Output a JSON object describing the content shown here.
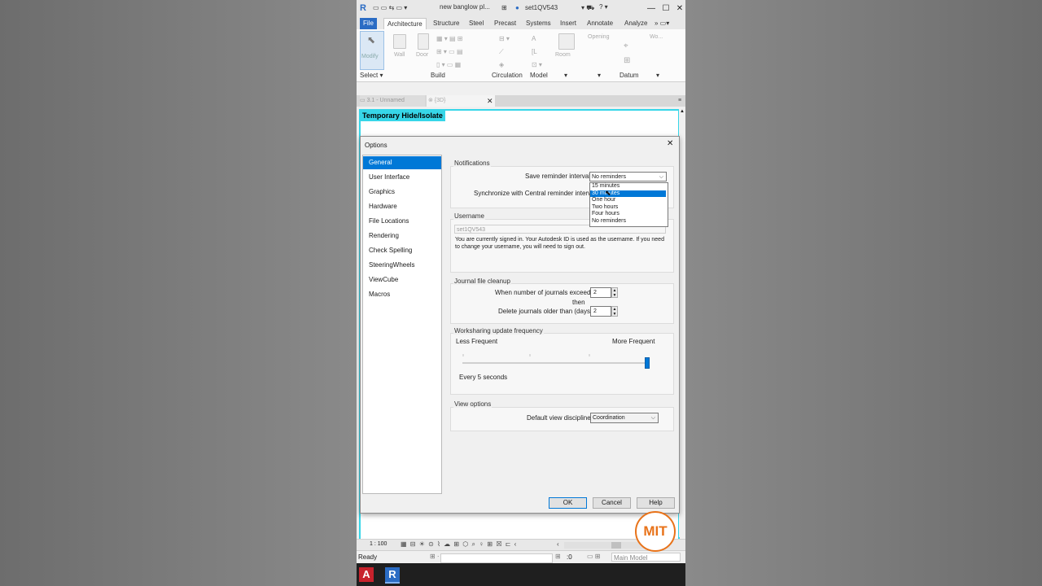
{
  "titlebar": {
    "doc_title": "new banglow pl...",
    "user": "set1QV543",
    "colors": {
      "accent": "#2b6cc4",
      "highlight": "#37d6e8"
    }
  },
  "ribbon": {
    "tabs": [
      "File",
      "Architecture",
      "Structure",
      "Steel",
      "Precast",
      "Systems",
      "Insert",
      "Annotate",
      "Analyze"
    ],
    "active_tab": "Architecture",
    "tools": {
      "modify": "Modify",
      "wall": "Wall",
      "door": "Door",
      "room": "Room",
      "opening": "Opening",
      "wo": "Wo..."
    },
    "panels": {
      "select": "Select",
      "build": "Build",
      "circulation": "Circulation",
      "model": "Model",
      "datum": "Datum"
    }
  },
  "views": {
    "tab1": "3.1 - Unnamed",
    "tab2": "{3D}",
    "temporary_label": "Temporary Hide/Isolate"
  },
  "dialog": {
    "title": "Options",
    "nav": [
      "General",
      "User Interface",
      "Graphics",
      "Hardware",
      "File Locations",
      "Rendering",
      "Check Spelling",
      "SteeringWheels",
      "ViewCube",
      "Macros"
    ],
    "selected_nav": "General",
    "notifications": {
      "group": "Notifications",
      "save_label": "Save reminder interval:",
      "save_value": "No reminders",
      "sync_label": "Synchronize with Central reminder interval:",
      "options": [
        "15 minutes",
        "30 minutes",
        "One hour",
        "Two hours",
        "Four hours",
        "No reminders"
      ],
      "highlighted": "30 minutes"
    },
    "username": {
      "group": "Username",
      "value": "set1QV543",
      "note": "You are currently signed in. Your Autodesk ID is used as the username. If you need to change your username, you will need to sign out."
    },
    "journal": {
      "group": "Journal file cleanup",
      "exceeds_label": "When number of journals exceeds:",
      "exceeds_value": "2",
      "then": "then",
      "delete_label": "Delete journals older than (days):",
      "delete_value": "2"
    },
    "worksharing": {
      "group": "Worksharing update frequency",
      "less": "Less Frequent",
      "more": "More Frequent",
      "level": 1.0,
      "value_text": "Every 5 seconds"
    },
    "view_options": {
      "group": "View options",
      "label": "Default view discipline:",
      "value": "Coordination"
    },
    "buttons": {
      "ok": "OK",
      "cancel": "Cancel",
      "help": "Help"
    }
  },
  "status": {
    "scale": "1 : 100",
    "ready": "Ready",
    "zero": ":0",
    "model": "Main Model"
  },
  "watermark": "MIT"
}
